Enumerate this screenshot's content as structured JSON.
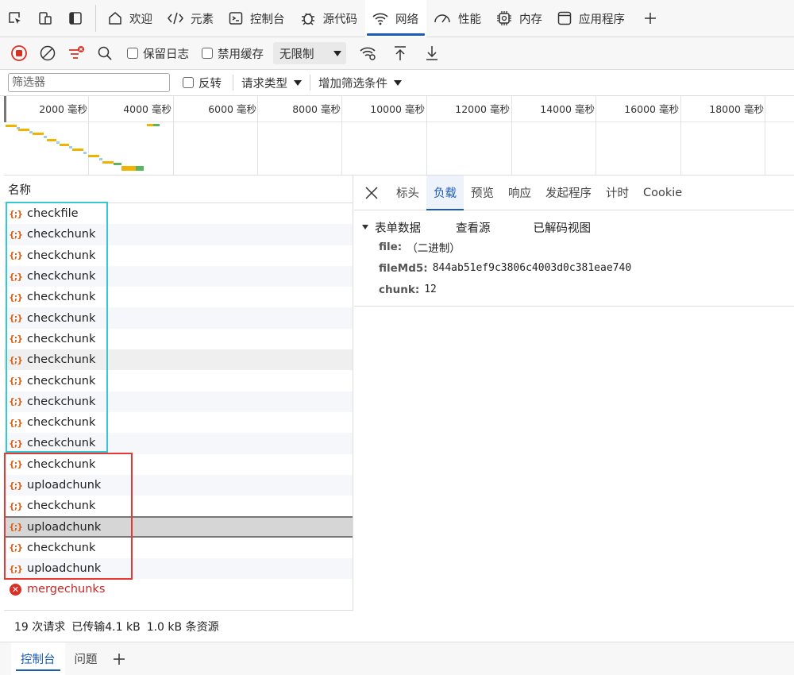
{
  "tabs": [
    {
      "label": "欢迎",
      "icon": "home-icon"
    },
    {
      "label": "元素",
      "icon": "code-icon"
    },
    {
      "label": "控制台",
      "icon": "console-icon"
    },
    {
      "label": "源代码",
      "icon": "bug-icon"
    },
    {
      "label": "网络",
      "icon": "wifi-icon",
      "active": true
    },
    {
      "label": "性能",
      "icon": "gauge-icon"
    },
    {
      "label": "内存",
      "icon": "chip-icon"
    },
    {
      "label": "应用程序",
      "icon": "app-window-icon"
    }
  ],
  "toolbar": {
    "preserve_log": "保留日志",
    "disable_cache": "禁用缓存",
    "throttle": "无限制"
  },
  "filter": {
    "placeholder": "筛选器",
    "invert": "反转",
    "request_type": "请求类型",
    "more_filters": "增加筛选条件"
  },
  "timeline": {
    "ticks": [
      "2000 毫秒",
      "4000 毫秒",
      "6000 毫秒",
      "8000 毫秒",
      "10000 毫秒",
      "12000 毫秒",
      "14000 毫秒",
      "16000 毫秒",
      "18000 毫秒"
    ]
  },
  "list": {
    "header": "名称",
    "rows": [
      {
        "name": "checkfile",
        "type": "fetch"
      },
      {
        "name": "checkchunk",
        "type": "fetch"
      },
      {
        "name": "checkchunk",
        "type": "fetch"
      },
      {
        "name": "checkchunk",
        "type": "fetch"
      },
      {
        "name": "checkchunk",
        "type": "fetch"
      },
      {
        "name": "checkchunk",
        "type": "fetch"
      },
      {
        "name": "checkchunk",
        "type": "fetch"
      },
      {
        "name": "checkchunk",
        "type": "fetch",
        "highlight": true
      },
      {
        "name": "checkchunk",
        "type": "fetch"
      },
      {
        "name": "checkchunk",
        "type": "fetch"
      },
      {
        "name": "checkchunk",
        "type": "fetch"
      },
      {
        "name": "checkchunk",
        "type": "fetch"
      },
      {
        "name": "checkchunk",
        "type": "fetch"
      },
      {
        "name": "uploadchunk",
        "type": "fetch"
      },
      {
        "name": "checkchunk",
        "type": "fetch"
      },
      {
        "name": "uploadchunk",
        "type": "fetch",
        "selected": true
      },
      {
        "name": "checkchunk",
        "type": "fetch"
      },
      {
        "name": "uploadchunk",
        "type": "fetch"
      },
      {
        "name": "mergechunks",
        "type": "error"
      }
    ],
    "status": {
      "requests": "19 次请求",
      "transferred": "已传输4.1 kB",
      "resources": "1.0 kB 条资源"
    }
  },
  "detail": {
    "tabs": [
      "标头",
      "负载",
      "预览",
      "响应",
      "发起程序",
      "计时",
      "Cookie"
    ],
    "active_tab": "负载",
    "payload": {
      "section_title": "表单数据",
      "view_source": "查看源",
      "view_decoded": "已解码视图",
      "fields": [
        {
          "key": "file:",
          "value": "（二进制）"
        },
        {
          "key": "fileMd5:",
          "value": "844ab51ef9c3806c4003d0c381eae740"
        },
        {
          "key": "chunk:",
          "value": "12"
        }
      ]
    }
  },
  "drawer": {
    "tabs": [
      "控制台",
      "问题"
    ],
    "active_tab": "控制台"
  },
  "colors": {
    "accent": "#1a5bb5",
    "record_red": "#d93025",
    "outline_cyan": "#35c7d3",
    "outline_red": "#e53935",
    "fetch_icon": "#d9641a"
  }
}
